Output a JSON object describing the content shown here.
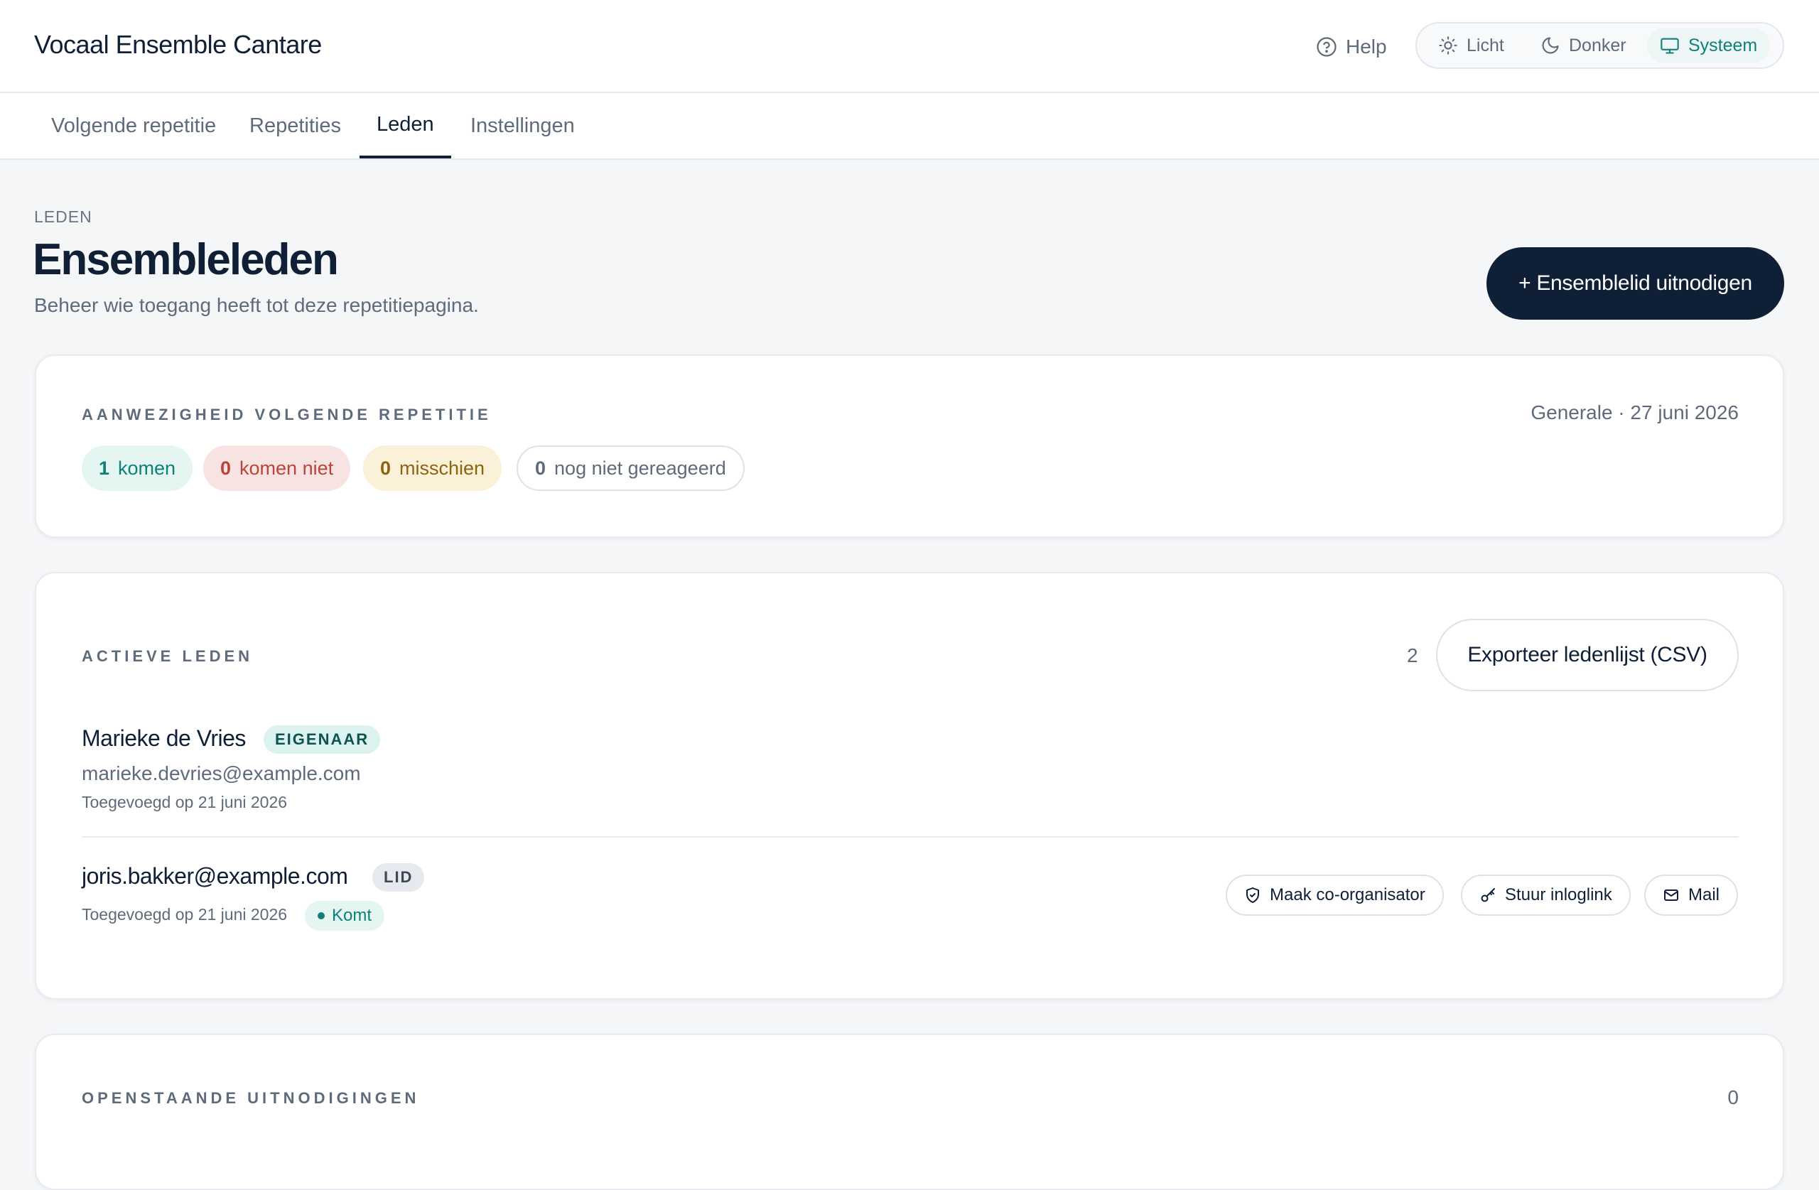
{
  "header": {
    "app_title": "Vocaal Ensemble Cantare",
    "help_label": "Help",
    "theme_options": [
      {
        "label": "Licht",
        "icon": "sun-icon",
        "active": false
      },
      {
        "label": "Donker",
        "icon": "moon-icon",
        "active": false
      },
      {
        "label": "Systeem",
        "icon": "monitor-icon",
        "active": true
      }
    ]
  },
  "tabs": [
    {
      "label": "Volgende repetitie",
      "active": false
    },
    {
      "label": "Repetities",
      "active": false
    },
    {
      "label": "Leden",
      "active": true
    },
    {
      "label": "Instellingen",
      "active": false
    }
  ],
  "page": {
    "eyebrow": "LEDEN",
    "title": "Ensembleleden",
    "subtitle": "Beheer wie toegang heeft tot deze repetitiepagina.",
    "invite_button": "+ Ensemblelid uitnodigen"
  },
  "attendance": {
    "label": "AANWEZIGHEID VOLGENDE REPETITIE",
    "meta": "Generale · 27 juni 2026",
    "pills": [
      {
        "count": "1",
        "label": "komen"
      },
      {
        "count": "0",
        "label": "komen niet"
      },
      {
        "count": "0",
        "label": "misschien"
      },
      {
        "count": "0",
        "label": "nog niet gereageerd"
      }
    ]
  },
  "active_members": {
    "label": "ACTIEVE LEDEN",
    "count": "2",
    "export_button": "Exporteer ledenlijst (CSV)",
    "members": [
      {
        "name": "Marieke de Vries",
        "role": "EIGENAAR",
        "email": "marieke.devries@example.com",
        "added": "Toegevoegd op 21 juni 2026"
      },
      {
        "name": "joris.bakker@example.com",
        "role": "LID",
        "added": "Toegevoegd op 21 juni 2026",
        "status": "Komt",
        "actions": [
          {
            "label": "Maak co-organisator",
            "icon": "shield-icon"
          },
          {
            "label": "Stuur inloglink",
            "icon": "key-icon"
          },
          {
            "label": "Mail",
            "icon": "mail-icon"
          }
        ]
      }
    ]
  },
  "pending_invites": {
    "label": "OPENSTAANDE UITNODIGINGEN",
    "count": "0"
  },
  "colors": {
    "primary": "#0f1f36",
    "accent": "#0f7f7a",
    "background": "#f4f6f8"
  }
}
